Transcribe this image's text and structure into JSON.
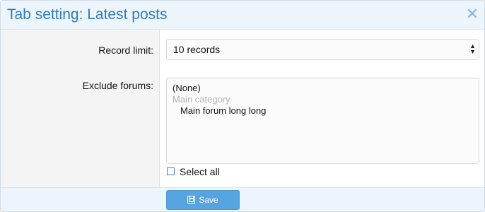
{
  "dialog": {
    "title": "Tab setting: Latest posts",
    "close_glyph": "✕",
    "close_icon": "close-icon"
  },
  "form": {
    "record_limit_label": "Record limit:",
    "record_limit_value": "10 records",
    "exclude_forums_label": "Exclude forums:",
    "forum_options": [
      {
        "label": "(None)",
        "type": "option"
      },
      {
        "label": "Main category",
        "type": "group"
      },
      {
        "label": "Main forum long long",
        "type": "option"
      }
    ],
    "select_all_label": "Select all",
    "select_all_checked": false
  },
  "footer": {
    "save_label": "Save",
    "save_icon": "floppy-disk-icon"
  },
  "colors": {
    "accent": "#2b7cbe",
    "button": "#56a4e0",
    "header_bg": "#edf5fc",
    "label_bg": "#f4f4f4"
  }
}
